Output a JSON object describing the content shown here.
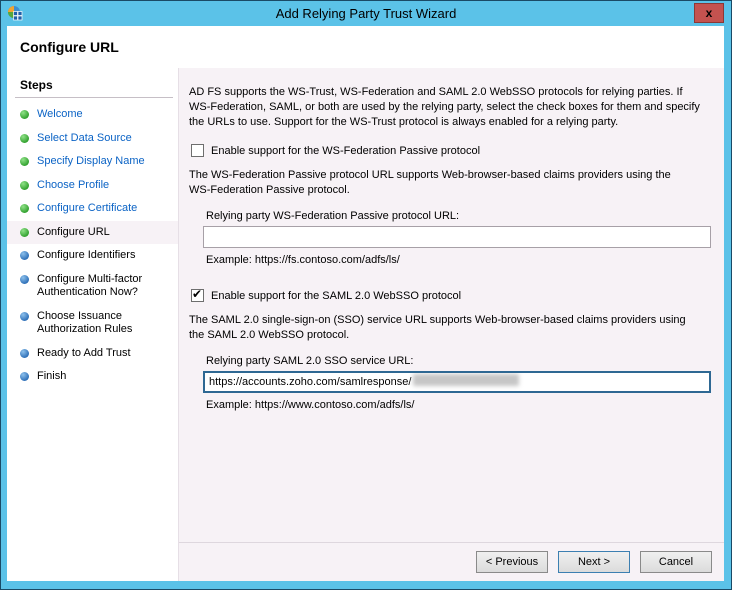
{
  "window": {
    "title": "Add Relying Party Trust Wizard",
    "close_glyph": "x"
  },
  "header": {
    "title": "Configure URL"
  },
  "sidebar": {
    "heading": "Steps",
    "items": [
      {
        "label": "Welcome",
        "state": "done"
      },
      {
        "label": "Select Data Source",
        "state": "done"
      },
      {
        "label": "Specify Display Name",
        "state": "done"
      },
      {
        "label": "Choose Profile",
        "state": "done"
      },
      {
        "label": "Configure Certificate",
        "state": "done"
      },
      {
        "label": "Configure URL",
        "state": "current"
      },
      {
        "label": "Configure Identifiers",
        "state": "upcoming"
      },
      {
        "label": "Configure Multi-factor Authentication Now?",
        "state": "upcoming"
      },
      {
        "label": "Choose Issuance Authorization Rules",
        "state": "upcoming"
      },
      {
        "label": "Ready to Add Trust",
        "state": "upcoming"
      },
      {
        "label": "Finish",
        "state": "upcoming"
      }
    ]
  },
  "main": {
    "intro": "AD FS supports the WS-Trust, WS-Federation and SAML 2.0 WebSSO protocols for relying parties.  If WS-Federation, SAML, or both are used by the relying party, select the check boxes for them and specify the URLs to use.  Support for the WS-Trust protocol is always enabled for a relying party.",
    "wsfed": {
      "checkbox_label": "Enable support for the WS-Federation Passive protocol",
      "checked": false,
      "description": "The WS-Federation Passive protocol URL supports Web-browser-based claims providers using the WS-Federation Passive protocol.",
      "url_label": "Relying party WS-Federation Passive protocol URL:",
      "url_value": "",
      "example": "Example: https://fs.contoso.com/adfs/ls/"
    },
    "saml": {
      "checkbox_label": "Enable support for the SAML 2.0 WebSSO protocol",
      "checked": true,
      "description": "The SAML 2.0 single-sign-on (SSO) service URL supports Web-browser-based claims providers using the SAML 2.0 WebSSO protocol.",
      "url_label": "Relying party SAML 2.0 SSO service URL:",
      "url_value": "https://accounts.zoho.com/samlresponse/",
      "url_value_redacted": true,
      "example": "Example: https://www.contoso.com/adfs/ls/"
    }
  },
  "footer": {
    "previous_label": "< Previous",
    "next_label": "Next >",
    "cancel_label": "Cancel"
  },
  "icons": {
    "check_glyph": "✔"
  },
  "colors": {
    "frame_blue": "#5BC2E8",
    "close_red": "#C4524F",
    "content_bg": "#F7F2F6",
    "link_blue": "#0B63C5",
    "done_bullet_green": "#2E9E2B",
    "upcoming_bullet_blue": "#2A6CB5",
    "focused_input_border": "#2E6893",
    "default_button_border": "#3C7FB1"
  }
}
